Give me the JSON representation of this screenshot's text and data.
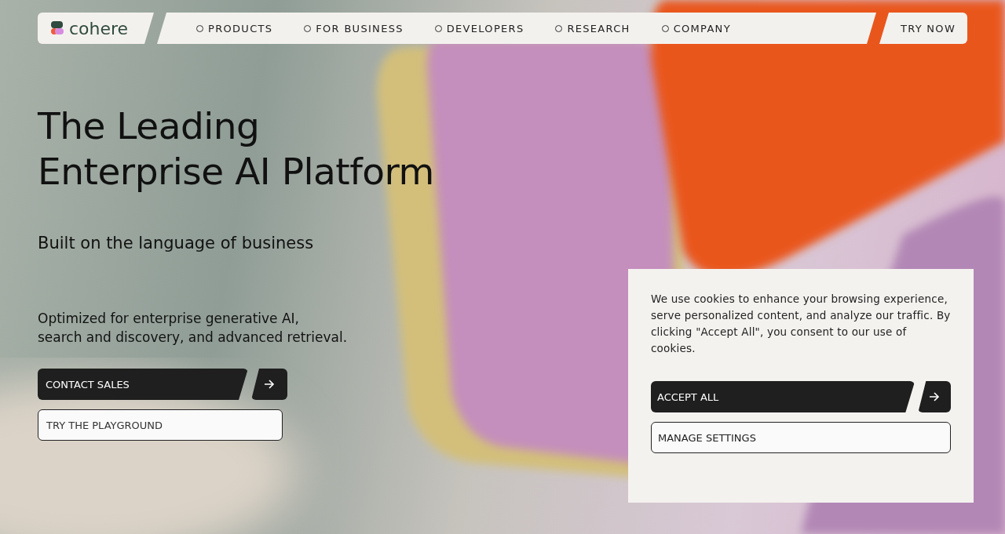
{
  "header": {
    "logo": "cohere",
    "nav": [
      {
        "label": "PRODUCTS"
      },
      {
        "label": "FOR BUSINESS"
      },
      {
        "label": "DEVELOPERS"
      },
      {
        "label": "RESEARCH"
      },
      {
        "label": "COMPANY"
      }
    ],
    "cta": "TRY NOW"
  },
  "hero": {
    "title_lines": [
      "The Leading",
      "Enterprise AI Platform"
    ],
    "subtitle": "Built on the language of business",
    "description_lines": [
      "Optimized for enterprise generative AI,",
      "search and discovery, and advanced retrieval."
    ],
    "primary_button": "CONTACT SALES",
    "secondary_button": "TRY THE PLAYGROUND"
  },
  "cookie_banner": {
    "text": "We use cookies to enhance your browsing experience, serve personalized content, and analyze our traffic. By clicking \"Accept All\", you consent to our use of cookies.",
    "accept_button": "ACCEPT ALL",
    "settings_button": "MANAGE SETTINGS"
  }
}
